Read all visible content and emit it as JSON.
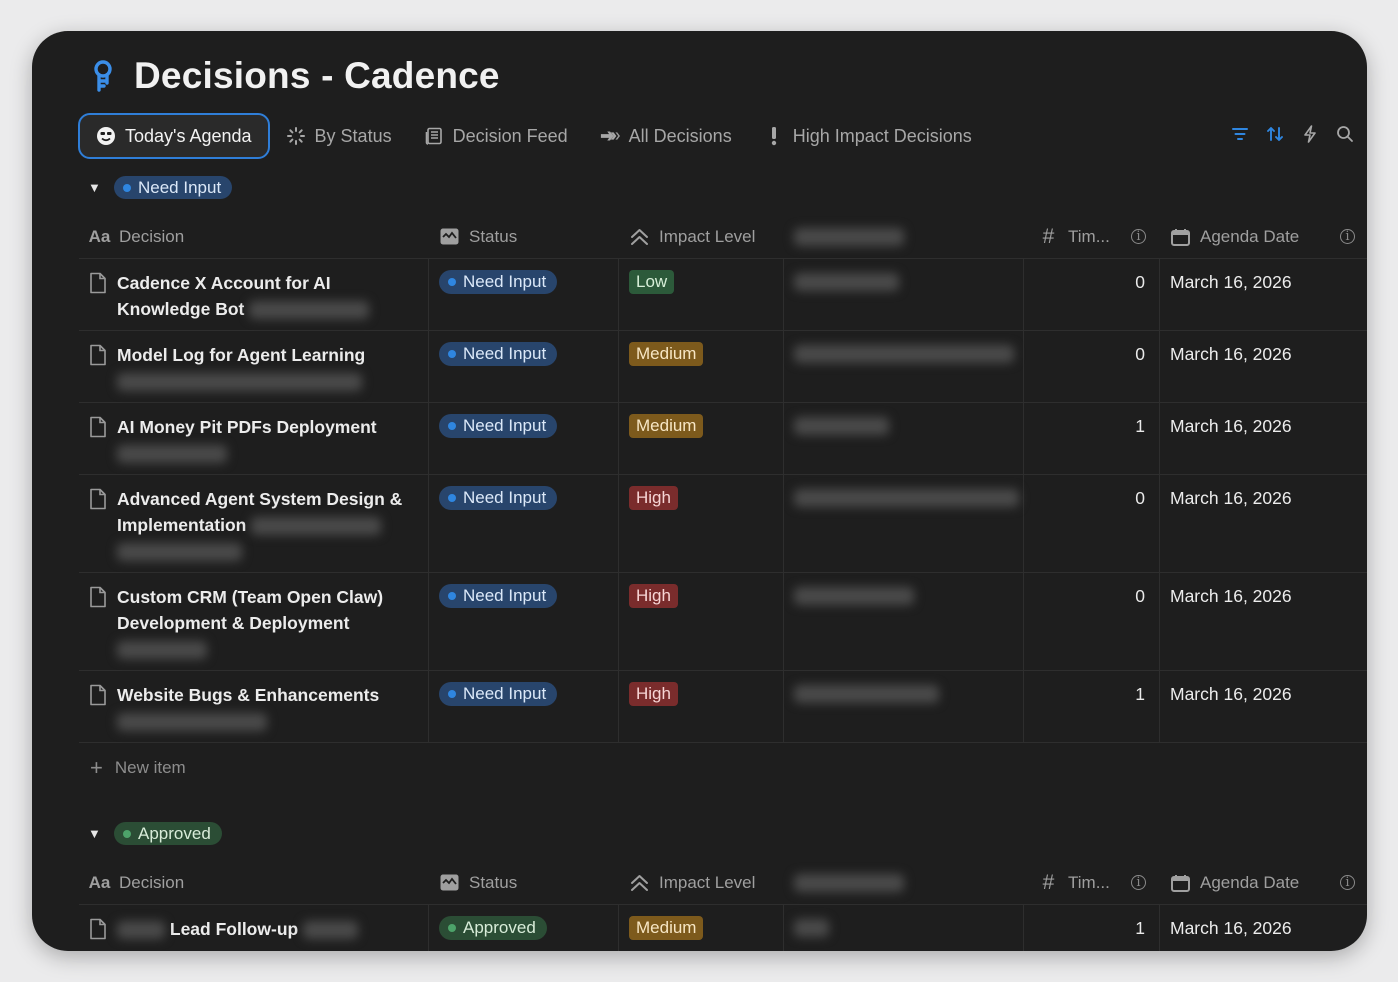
{
  "page": {
    "title": "Decisions - Cadence",
    "icon": "agent-key-icon"
  },
  "tabs": [
    {
      "label": "Today's Agenda",
      "icon": "smiley-icon",
      "active": true
    },
    {
      "label": "By Status",
      "icon": "loading-spinner-icon"
    },
    {
      "label": "Decision Feed",
      "icon": "feed-icon"
    },
    {
      "label": "All Decisions",
      "icon": "arrows-icon"
    },
    {
      "label": "High Impact Decisions",
      "icon": "exclamation-icon"
    }
  ],
  "toolbar": {
    "filter": "filter-icon",
    "sort": "sort-icon",
    "automation": "lightning-icon",
    "search": "search-icon"
  },
  "columns": {
    "decision": "Decision",
    "status": "Status",
    "impact": "Impact Level",
    "times": "Tim...",
    "agenda_date": "Agenda Date"
  },
  "groups": [
    {
      "label": "Need Input",
      "color": "#2f86e0",
      "rows": [
        {
          "title": "Cadence X Account for AI Knowledge Bot",
          "status": "Need Input",
          "impact": "Low",
          "times": "0",
          "date": "March 16, 2026"
        },
        {
          "title": "Model Log for Agent Learning",
          "status": "Need Input",
          "impact": "Medium",
          "times": "0",
          "date": "March 16, 2026"
        },
        {
          "title": "AI Money Pit PDFs Deployment",
          "status": "Need Input",
          "impact": "Medium",
          "times": "1",
          "date": "March 16, 2026"
        },
        {
          "title": "Advanced Agent System Design & Implementation",
          "status": "Need Input",
          "impact": "High",
          "times": "0",
          "date": "March 16, 2026"
        },
        {
          "title": "Custom CRM (Team Open Claw) Development & Deployment",
          "status": "Need Input",
          "impact": "High",
          "times": "0",
          "date": "March 16, 2026"
        },
        {
          "title": "Website Bugs & Enhancements",
          "status": "Need Input",
          "impact": "High",
          "times": "1",
          "date": "March 16, 2026"
        }
      ],
      "new_item": "New item"
    },
    {
      "label": "Approved",
      "color": "#4da36a",
      "rows": [
        {
          "title": "Lead Follow-up",
          "status": "Approved",
          "impact": "Medium",
          "times": "1",
          "date": "March 16, 2026"
        }
      ]
    }
  ]
}
